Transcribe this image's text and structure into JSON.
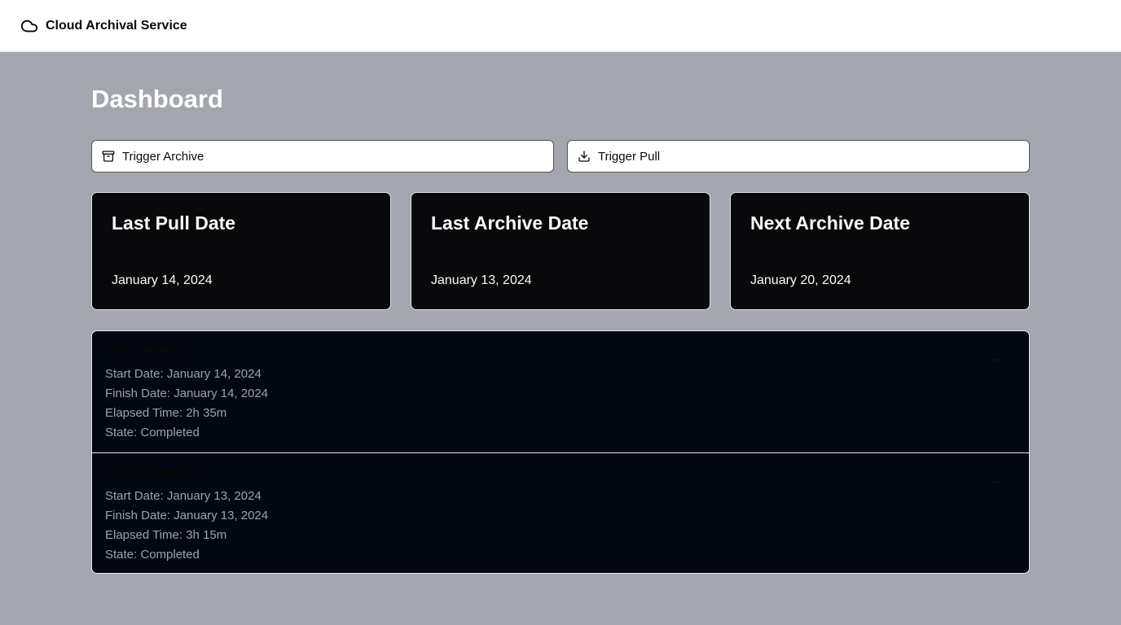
{
  "header": {
    "brand_icon": "cloud-icon",
    "app_name": "Cloud Archival Service"
  },
  "page": {
    "title": "Dashboard"
  },
  "actions": {
    "archive": {
      "icon": "archive-box-icon",
      "label": "Trigger Archive"
    },
    "pull": {
      "icon": "download-icon",
      "label": "Trigger Pull"
    }
  },
  "stats": [
    {
      "title": "Last Pull Date",
      "value": "January 14, 2024"
    },
    {
      "title": "Last Archive Date",
      "value": "January 13, 2024"
    },
    {
      "title": "Next Archive Date",
      "value": "January 20, 2024"
    }
  ],
  "attempts": [
    {
      "title": "Pull Attempt 1",
      "start": "Start Date: January 14, 2024",
      "finish": "Finish Date: January 14, 2024",
      "elapsed": "Elapsed Time: 2h 35m",
      "state": "State: Completed",
      "menu": "···"
    },
    {
      "title": "Archive Attempt 1",
      "start": "Start Date: January 13, 2024",
      "finish": "Finish Date: January 13, 2024",
      "elapsed": "Elapsed Time: 3h 15m",
      "state": "State: Completed",
      "menu": "···"
    }
  ],
  "colors": {
    "page_background": "#a3a6ae",
    "card_background": "#09090b",
    "list_background": "#030712",
    "header_background": "#ffffff"
  }
}
